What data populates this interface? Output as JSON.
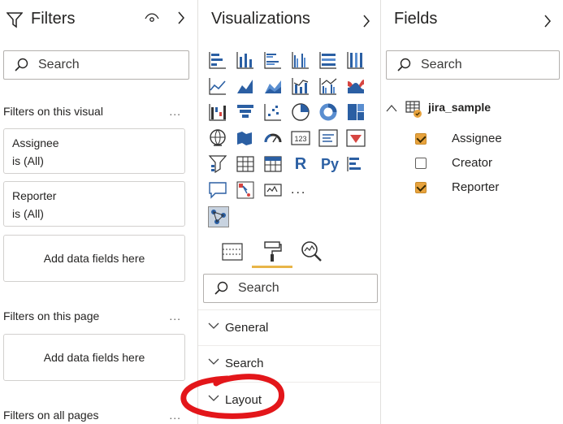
{
  "filters": {
    "title": "Filters",
    "search_placeholder": "Search",
    "sections": [
      {
        "label": "Filters on this visual",
        "more": "..."
      },
      {
        "label": "Filters on this page",
        "more": "..."
      },
      {
        "label": "Filters on all pages",
        "more": "..."
      }
    ],
    "cards": [
      {
        "field": "Assignee",
        "state": "is (All)"
      },
      {
        "field": "Reporter",
        "state": "is (All)"
      }
    ],
    "drop_visual": "Add data fields here",
    "drop_page": "Add data fields here"
  },
  "visualizations": {
    "title": "Visualizations",
    "search_placeholder": "Search",
    "more_visuals": "...",
    "r_label": "R",
    "py_label": "Py",
    "table_label": "123",
    "accordion": [
      {
        "label": "General"
      },
      {
        "label": "Search"
      },
      {
        "label": "Layout"
      }
    ],
    "colors": {
      "accent": "#e8b548",
      "icon_blue": "#2b5fa3",
      "icon_red": "#d64541"
    }
  },
  "fields": {
    "title": "Fields",
    "search_placeholder": "Search",
    "table_name": "jira_sample",
    "items": [
      {
        "label": "Assignee",
        "checked": true
      },
      {
        "label": "Creator",
        "checked": false
      },
      {
        "label": "Reporter",
        "checked": true
      }
    ],
    "colors": {
      "checkbox": "#e8a33d"
    }
  },
  "annotation": {
    "color": "#e3161a"
  }
}
